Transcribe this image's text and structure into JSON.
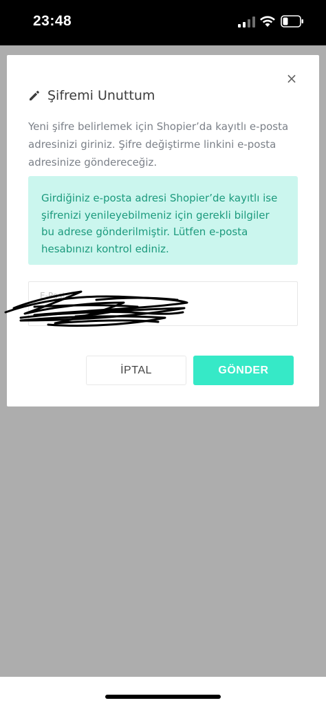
{
  "status_bar": {
    "time": "23:48"
  },
  "modal": {
    "close_symbol": "×",
    "title": "Şifremi Unuttum",
    "title_icon": "pencil-icon",
    "description": "Yeni şifre belirlemek için Shopier’da kayıtlı e-posta adresinizi giriniz. Şifre değiştirme linkini e-posta adresinize göndereceğiz.",
    "alert_text": "Girdiğiniz e-posta adresi Shopier’de kayıtlı ise şifrenizi yenileyebilmeniz için gerekli bilgiler bu adrese gönderilmiştir. Lütfen e-posta hesabınızı kontrol ediniz.",
    "email": {
      "label": "E-Posta",
      "value": ""
    },
    "cancel_label": "İPTAL",
    "submit_label": "GÖNDER"
  },
  "colors": {
    "accent": "#36e9c7",
    "alert_background": "#cbf6ee",
    "alert_text": "#1c9a7d",
    "backdrop": "#adadad"
  }
}
